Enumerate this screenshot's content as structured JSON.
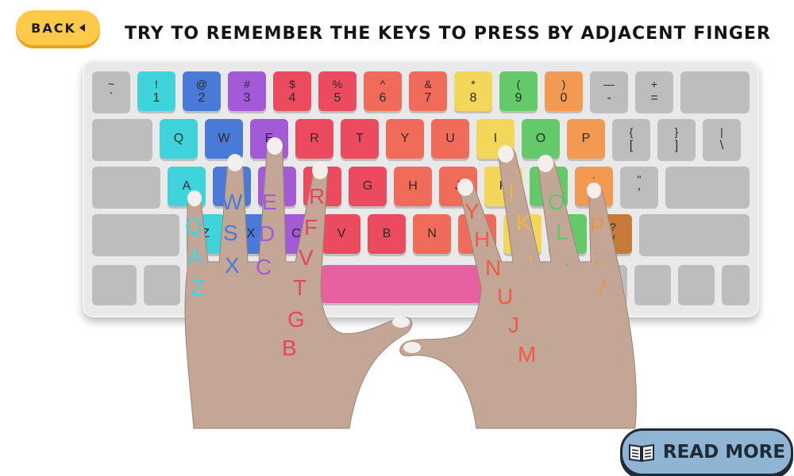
{
  "back": {
    "label": "BACK"
  },
  "title": "TRY TO REMEMBER THE KEYS TO PRESS BY ADJACENT FINGER",
  "read_more": {
    "label": "READ MORE"
  },
  "colors": {
    "gray": "#bdbdbd",
    "cyan": "#3fd3dc",
    "blue": "#4a7ad8",
    "purple": "#a35ad6",
    "red": "#ec4b5f",
    "salmon": "#f16b5b",
    "yellow": "#f3d75a",
    "green": "#63c969",
    "orange": "#f29a52",
    "brown": "#c77a3a",
    "pink": "#e7609f"
  },
  "keyboard": {
    "row1": [
      {
        "top": "~",
        "bottom": "`",
        "color": "gray"
      },
      {
        "top": "!",
        "bottom": "1",
        "color": "cyan"
      },
      {
        "top": "@",
        "bottom": "2",
        "color": "blue"
      },
      {
        "top": "#",
        "bottom": "3",
        "color": "purple"
      },
      {
        "top": "$",
        "bottom": "4",
        "color": "red"
      },
      {
        "top": "%",
        "bottom": "5",
        "color": "red"
      },
      {
        "top": "^",
        "bottom": "6",
        "color": "salmon"
      },
      {
        "top": "&",
        "bottom": "7",
        "color": "salmon"
      },
      {
        "top": "*",
        "bottom": "8",
        "color": "yellow"
      },
      {
        "top": "(",
        "bottom": "9",
        "color": "green"
      },
      {
        "top": ")",
        "bottom": "0",
        "color": "orange"
      },
      {
        "top": "—",
        "bottom": "-",
        "color": "gray"
      },
      {
        "top": "+",
        "bottom": "=",
        "color": "gray"
      }
    ],
    "row2": [
      {
        "label": "Q",
        "color": "cyan"
      },
      {
        "label": "W",
        "color": "blue"
      },
      {
        "label": "E",
        "color": "purple"
      },
      {
        "label": "R",
        "color": "red"
      },
      {
        "label": "T",
        "color": "red"
      },
      {
        "label": "Y",
        "color": "salmon"
      },
      {
        "label": "U",
        "color": "salmon"
      },
      {
        "label": "I",
        "color": "yellow"
      },
      {
        "label": "O",
        "color": "green"
      },
      {
        "label": "P",
        "color": "orange"
      },
      {
        "top": "{",
        "bottom": "[",
        "color": "gray"
      },
      {
        "top": "}",
        "bottom": "]",
        "color": "gray"
      },
      {
        "top": "|",
        "bottom": "\\",
        "color": "gray"
      }
    ],
    "row3": [
      {
        "label": "A",
        "color": "cyan"
      },
      {
        "label": "S",
        "color": "blue"
      },
      {
        "label": "D",
        "color": "purple"
      },
      {
        "label": "F",
        "color": "red"
      },
      {
        "label": "G",
        "color": "red"
      },
      {
        "label": "H",
        "color": "salmon"
      },
      {
        "label": "J",
        "color": "salmon"
      },
      {
        "label": "K",
        "color": "yellow"
      },
      {
        "label": "L",
        "color": "green"
      },
      {
        "top": ":",
        "bottom": ";",
        "color": "orange"
      },
      {
        "top": "\"",
        "bottom": "'",
        "color": "gray"
      }
    ],
    "row4": [
      {
        "label": "Z",
        "color": "cyan"
      },
      {
        "label": "X",
        "color": "blue"
      },
      {
        "label": "C",
        "color": "purple"
      },
      {
        "label": "V",
        "color": "red"
      },
      {
        "label": "B",
        "color": "red"
      },
      {
        "label": "N",
        "color": "salmon"
      },
      {
        "label": "M",
        "color": "salmon"
      },
      {
        "top": "<",
        "bottom": ",",
        "color": "yellow"
      },
      {
        "top": ">",
        "bottom": ".",
        "color": "green"
      },
      {
        "top": "?",
        "bottom": "/",
        "color": "brown"
      }
    ]
  },
  "finger_letters": {
    "left_pinky": [
      "Q",
      "A",
      "Z"
    ],
    "left_ring": [
      "W",
      "S",
      "X"
    ],
    "left_middle": [
      "E",
      "D",
      "C"
    ],
    "left_index": [
      "R",
      "F",
      "V",
      "T",
      "G",
      "B"
    ],
    "right_index": [
      "Y",
      "H",
      "N",
      "U",
      "J",
      "M"
    ],
    "right_middle": [
      "I",
      "K",
      ","
    ],
    "right_ring": [
      "O",
      "L",
      "."
    ],
    "right_pinky": [
      "P",
      ";",
      "/"
    ]
  }
}
